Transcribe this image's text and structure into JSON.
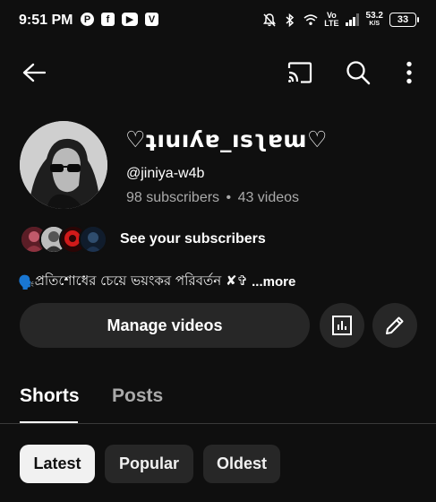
{
  "status_bar": {
    "time": "9:51 PM",
    "network_label": "Vo\nLTE",
    "net_speed_value": "53.2",
    "net_speed_unit": "K/S",
    "battery": "33",
    "app_icons": [
      "pinterest-icon",
      "facebook-icon",
      "youtube-icon",
      "vpn-icon"
    ]
  },
  "app_bar": {
    "icons": [
      "back-arrow-icon",
      "cast-icon",
      "search-icon",
      "more-vertical-icon"
    ]
  },
  "channel": {
    "name": "♡ʇıuıʎɐ_ısʅɐɯ♡",
    "handle": "@jiniya-w4b",
    "subscribers": "98 subscribers",
    "separator": "•",
    "videos": "43 videos",
    "see_subscribers_label": "See your subscribers",
    "bio_emoji": "🗣️",
    "bio_text": "প্রতিশোধের চেয়ে ভয়ংকর পরিবর্তন ✘✞",
    "bio_more": "...more"
  },
  "actions": {
    "manage_videos_label": "Manage videos",
    "analytics_icon": "analytics-icon",
    "edit_icon": "pencil-icon"
  },
  "tabs": [
    {
      "label": "Shorts",
      "active": true
    },
    {
      "label": "Posts",
      "active": false
    }
  ],
  "sort_chips": [
    {
      "label": "Latest",
      "selected": true
    },
    {
      "label": "Popular",
      "selected": false
    },
    {
      "label": "Oldest",
      "selected": false
    }
  ],
  "colors": {
    "background": "#0f0f0f",
    "surface": "#272727",
    "secondary_text": "#aaaaaa",
    "chip_selected": "#f1f1f1"
  }
}
